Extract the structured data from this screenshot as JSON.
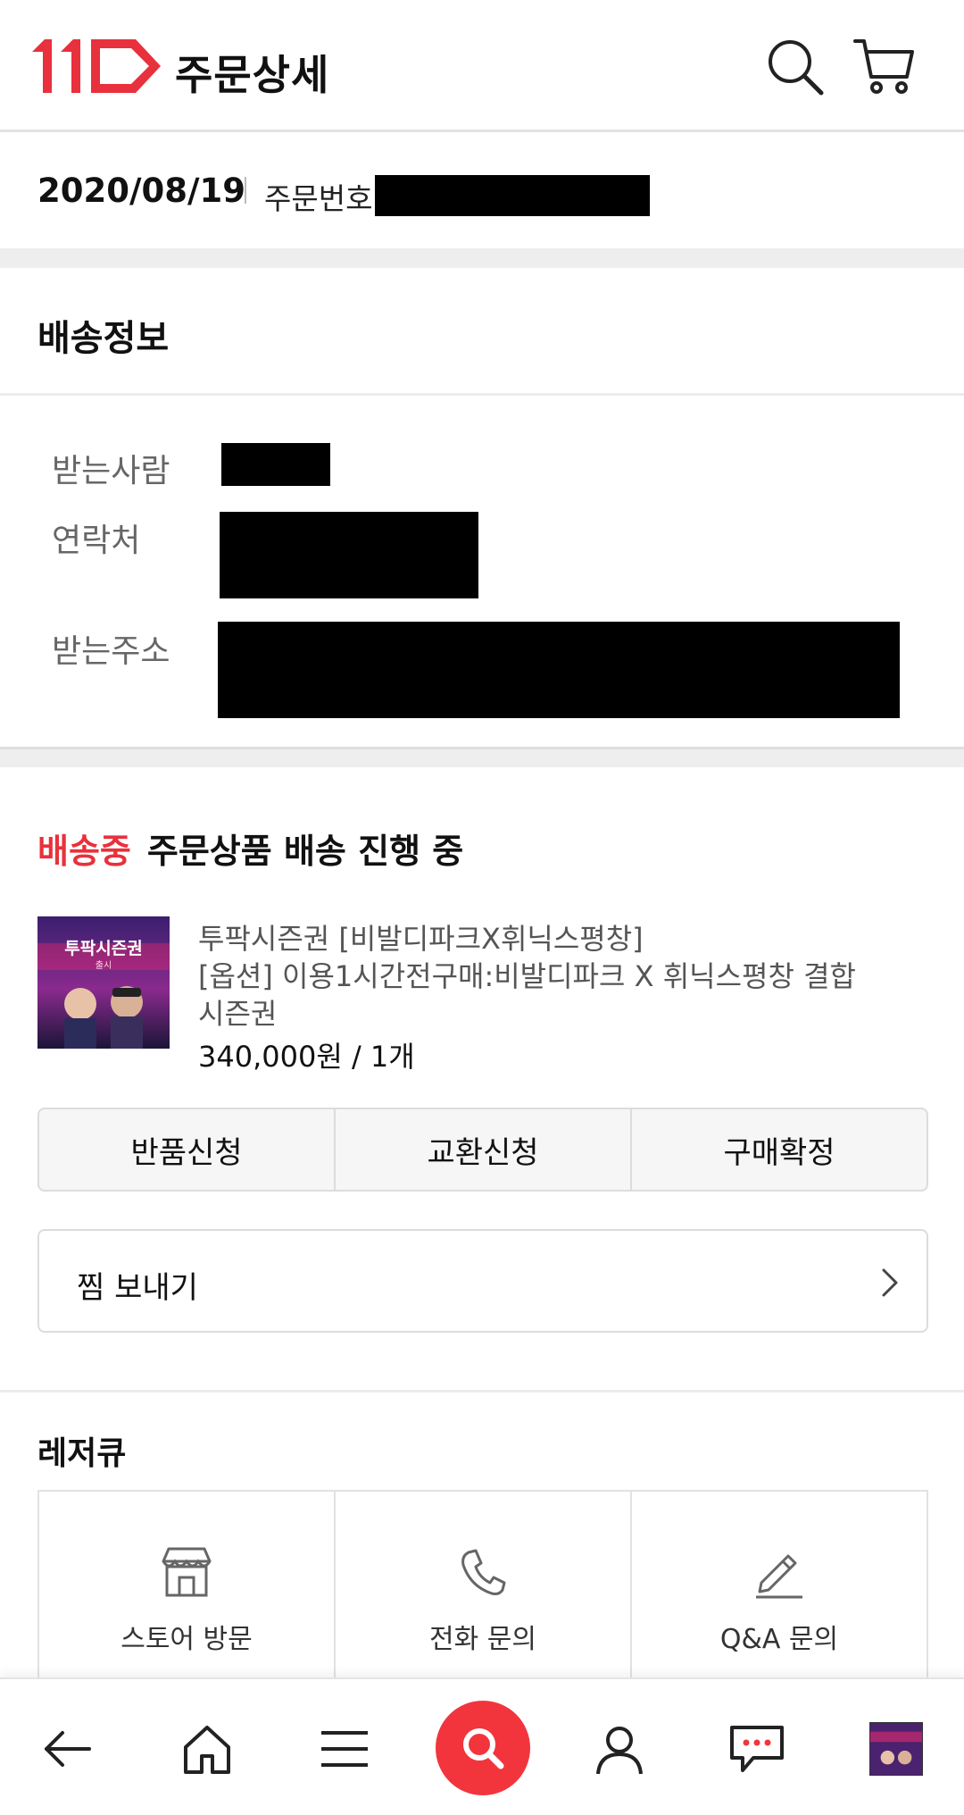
{
  "header": {
    "title": "주문상세",
    "logo_alt": "11번가",
    "search_icon": "search-icon",
    "cart_icon": "cart-icon"
  },
  "order": {
    "date": "2020/08/19",
    "number_label": "주문번호"
  },
  "shipping": {
    "title": "배송정보",
    "recipient_label": "받는사람",
    "contact_label": "연락처",
    "address_label": "받는주소"
  },
  "status": {
    "state": "배송중",
    "message": "주문상품 배송 진행 중"
  },
  "product": {
    "name": "투팍시즌권 [비발디파크X휘닉스평창]",
    "option_line1": "[옵션] 이용1시간전구매:비발디파크 X 휘닉스평창 결합",
    "option_line2": "시즌권",
    "price": "340,000원 / 1개",
    "thumb_text": "투팍시즌권",
    "thumb_sub": "출시"
  },
  "actions": {
    "return_label": "반품신청",
    "exchange_label": "교환신청",
    "confirm_label": "구매확정",
    "gift_label": "찜 보내기"
  },
  "seller": {
    "name": "레저큐",
    "visit_label": "스토어 방문",
    "call_label": "전화 문의",
    "qna_label": "Q&A 문의"
  },
  "colors": {
    "accent": "#e8313c",
    "search_button": "#f2353d"
  },
  "bottom_nav": {
    "icons": [
      "back-arrow-icon",
      "home-icon",
      "menu-icon",
      "search-icon",
      "user-icon",
      "chat-icon",
      "recent-product-thumb"
    ]
  }
}
